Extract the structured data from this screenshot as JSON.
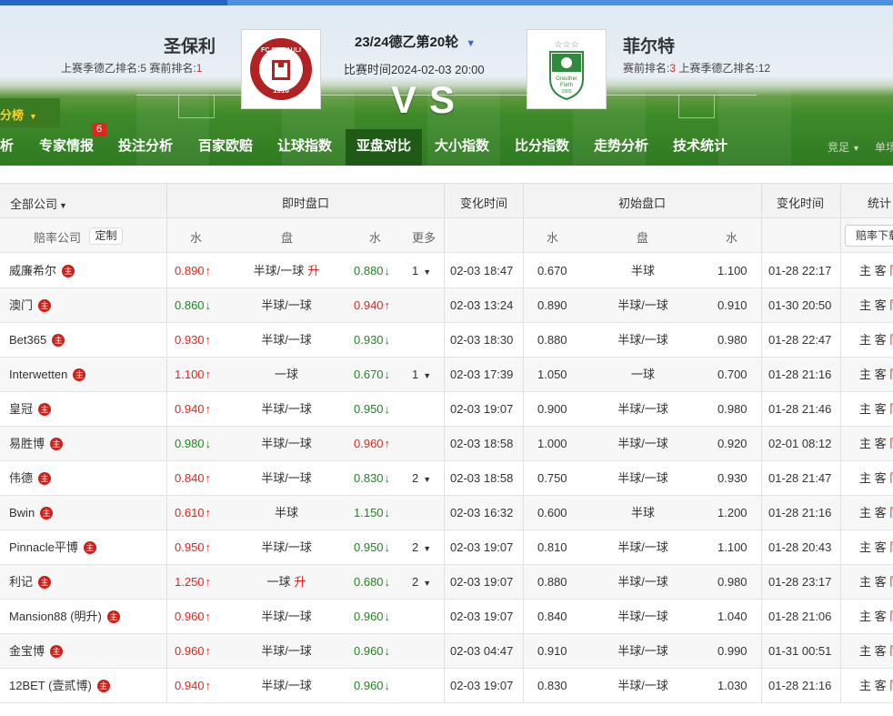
{
  "match": {
    "home_name": "圣保利",
    "home_sub_prefix": "上赛季德乙排名:5  赛前排名:",
    "home_rank": "1",
    "away_name": "菲尔特",
    "away_sub_prefix": "赛前排名:",
    "away_rank": "3",
    "away_sub_suffix": "  上赛季德乙排名:12",
    "round": "23/24德乙第20轮",
    "time": "比赛时间2024-02-03 20:00",
    "vs": "VS",
    "home_badge_text": "FC ST. PAULI 1910",
    "away_badge_text": "SpVgg Greuther Fürth 1903"
  },
  "nav": {
    "left_tab": "分榜",
    "badge": "6",
    "items": [
      "析",
      "专家情报",
      "投注分析",
      "百家欧赔",
      "让球指数",
      "亚盘对比",
      "大小指数",
      "比分指数",
      "走势分析",
      "技术统计"
    ],
    "active": "亚盘对比",
    "right_1": "竞足",
    "right_2": "单场"
  },
  "table": {
    "company_all": "全部公司",
    "live": "即时盘口",
    "change_time": "变化时间",
    "initial": "初始盘口",
    "stats": "统计",
    "odds_company": "赔率公司",
    "custom": "定制",
    "water": "水",
    "handicap": "盘",
    "more": "更多",
    "download": "赔率下载",
    "home_away": "主 客 同",
    "zhu": "主"
  },
  "colors": {
    "up": "#e0261c",
    "down": "#1a8a1a",
    "nav_active": "#1f5a17"
  },
  "rows": [
    {
      "company": "威廉希尔",
      "w1": "0.890",
      "d1": "up",
      "pan": "半球/一球",
      "sheng": "升",
      "w2": "0.880",
      "d2": "down",
      "more": "1",
      "time": "02-03 18:47",
      "iw1": "0.670",
      "ipan": "半球",
      "iw2": "1.100",
      "itime": "01-28 22:17"
    },
    {
      "company": "澳门",
      "w1": "0.860",
      "d1": "down",
      "pan": "半球/一球",
      "sheng": "",
      "w2": "0.940",
      "d2": "up",
      "more": "",
      "time": "02-03 13:24",
      "iw1": "0.890",
      "ipan": "半球/一球",
      "iw2": "0.910",
      "itime": "01-30 20:50"
    },
    {
      "company": "Bet365",
      "w1": "0.930",
      "d1": "up",
      "pan": "半球/一球",
      "sheng": "",
      "w2": "0.930",
      "d2": "down",
      "more": "",
      "time": "02-03 18:30",
      "iw1": "0.880",
      "ipan": "半球/一球",
      "iw2": "0.980",
      "itime": "01-28 22:47"
    },
    {
      "company": "Interwetten",
      "w1": "1.100",
      "d1": "up",
      "pan": "一球",
      "sheng": "",
      "w2": "0.670",
      "d2": "down",
      "more": "1",
      "time": "02-03 17:39",
      "iw1": "1.050",
      "ipan": "一球",
      "iw2": "0.700",
      "itime": "01-28 21:16"
    },
    {
      "company": "皇冠",
      "w1": "0.940",
      "d1": "up",
      "pan": "半球/一球",
      "sheng": "",
      "w2": "0.950",
      "d2": "down",
      "more": "",
      "time": "02-03 19:07",
      "iw1": "0.900",
      "ipan": "半球/一球",
      "iw2": "0.980",
      "itime": "01-28 21:46"
    },
    {
      "company": "易胜博",
      "w1": "0.980",
      "d1": "down",
      "pan": "半球/一球",
      "sheng": "",
      "w2": "0.960",
      "d2": "up",
      "more": "",
      "time": "02-03 18:58",
      "iw1": "1.000",
      "ipan": "半球/一球",
      "iw2": "0.920",
      "itime": "02-01 08:12"
    },
    {
      "company": "伟德",
      "w1": "0.840",
      "d1": "up",
      "pan": "半球/一球",
      "sheng": "",
      "w2": "0.830",
      "d2": "down",
      "more": "2",
      "time": "02-03 18:58",
      "iw1": "0.750",
      "ipan": "半球/一球",
      "iw2": "0.930",
      "itime": "01-28 21:47"
    },
    {
      "company": "Bwin",
      "w1": "0.610",
      "d1": "up",
      "pan": "半球",
      "sheng": "",
      "w2": "1.150",
      "d2": "down",
      "more": "",
      "time": "02-03 16:32",
      "iw1": "0.600",
      "ipan": "半球",
      "iw2": "1.200",
      "itime": "01-28 21:16"
    },
    {
      "company": "Pinnacle平博",
      "w1": "0.950",
      "d1": "up",
      "pan": "半球/一球",
      "sheng": "",
      "w2": "0.950",
      "d2": "down",
      "more": "2",
      "time": "02-03 19:07",
      "iw1": "0.810",
      "ipan": "半球/一球",
      "iw2": "1.100",
      "itime": "01-28 20:43"
    },
    {
      "company": "利记",
      "w1": "1.250",
      "d1": "up",
      "pan": "一球",
      "sheng": "升",
      "w2": "0.680",
      "d2": "down",
      "more": "2",
      "time": "02-03 19:07",
      "iw1": "0.880",
      "ipan": "半球/一球",
      "iw2": "0.980",
      "itime": "01-28 23:17"
    },
    {
      "company": "Mansion88 (明升)",
      "w1": "0.960",
      "d1": "up",
      "pan": "半球/一球",
      "sheng": "",
      "w2": "0.960",
      "d2": "down",
      "more": "",
      "time": "02-03 19:07",
      "iw1": "0.840",
      "ipan": "半球/一球",
      "iw2": "1.040",
      "itime": "01-28 21:06"
    },
    {
      "company": "金宝博",
      "w1": "0.960",
      "d1": "up",
      "pan": "半球/一球",
      "sheng": "",
      "w2": "0.960",
      "d2": "down",
      "more": "",
      "time": "02-03 04:47",
      "iw1": "0.910",
      "ipan": "半球/一球",
      "iw2": "0.990",
      "itime": "01-31 00:51"
    },
    {
      "company": "12BET (壹贰博)",
      "w1": "0.940",
      "d1": "up",
      "pan": "半球/一球",
      "sheng": "",
      "w2": "0.960",
      "d2": "down",
      "more": "",
      "time": "02-03 19:07",
      "iw1": "0.830",
      "ipan": "半球/一球",
      "iw2": "1.030",
      "itime": "01-28 21:16"
    }
  ]
}
